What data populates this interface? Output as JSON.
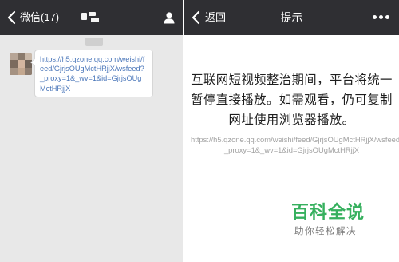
{
  "left_screen": {
    "header": {
      "back_label": "微信(17)"
    },
    "message": {
      "link_text": "https://h5.qzone.qq.com/weishi/feed/GjrjsOUgMctHRjjX/wsfeed?_proxy=1&_wv=1&id=GjrjsOUgMctHRjjX"
    }
  },
  "right_screen": {
    "header": {
      "back_label": "返回",
      "title": "提示"
    },
    "notice_text": "互联网短视频整治期间，平台将统一暂停直接播放。如需观看，仍可复制网址使用浏览器播放。",
    "url_text": "https://h5.qzone.qq.com/weishi/feed/GjrjsOUgMctHRjjX/wsfeed?_proxy=1&_wv=1&id=GjrjsOUgMctHRjjX"
  },
  "watermark": {
    "title": "百科全说",
    "subtitle": "助你轻松解决"
  },
  "colors": {
    "header_bg": "#2f2f33",
    "chat_bg": "#e8e8e8",
    "link": "#4b77ba",
    "watermark_green": "#36b05e"
  }
}
